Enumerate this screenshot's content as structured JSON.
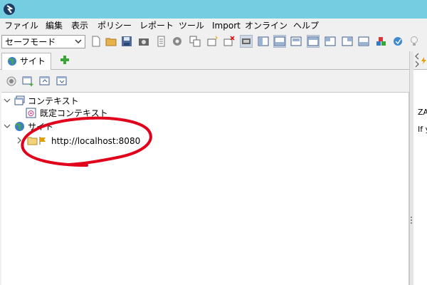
{
  "menubar": {
    "items": [
      "ファイル",
      "編集",
      "表示",
      "ポリシー",
      "レポート",
      "ツール",
      "Import",
      "オンライン",
      "ヘルプ"
    ]
  },
  "toolbar": {
    "mode_select_value": "セーフモード"
  },
  "sites_tab": {
    "label": "サイト"
  },
  "tree": {
    "contexts_label": "コンテキスト",
    "default_context_label": "既定コンテキスト",
    "sites_label": "サイト",
    "site_node_label": "http://localhost:8080"
  },
  "right_panel": {
    "text_line_1": "ZA",
    "text_line_2": "If y"
  },
  "colors": {
    "titlebar": "#74cde0",
    "annotation": "#e0001b"
  }
}
